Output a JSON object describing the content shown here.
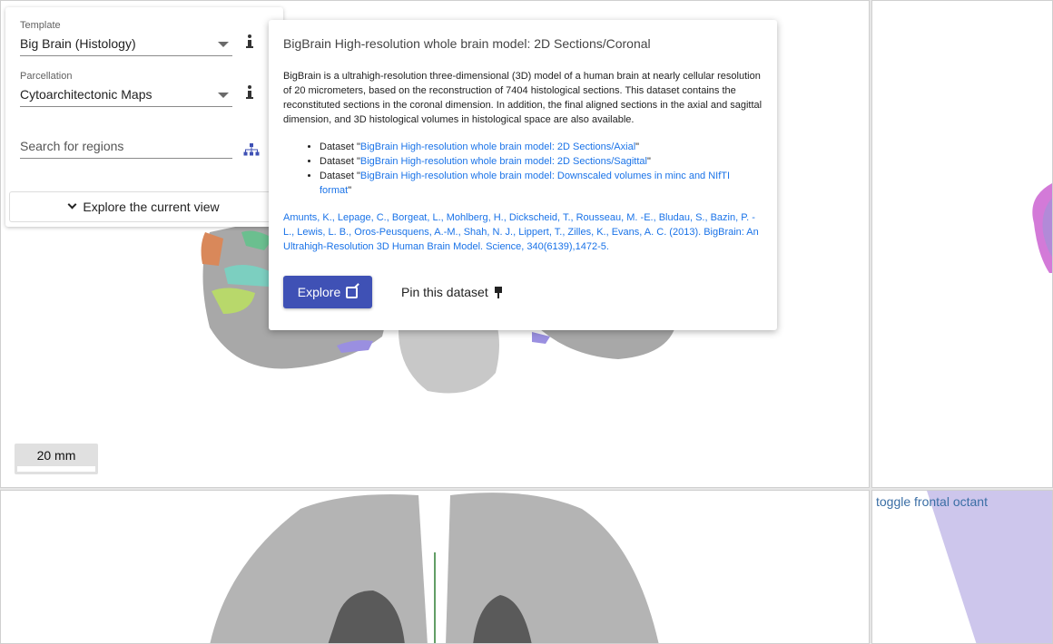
{
  "sidebar": {
    "template_label": "Template",
    "template_value": "Big Brain (Histology)",
    "parcellation_label": "Parcellation",
    "parcellation_value": "Cytoarchitectonic Maps",
    "search_placeholder": "Search for regions",
    "explore_view_label": "Explore the current view"
  },
  "popup": {
    "title": "BigBrain High-resolution whole brain model: 2D Sections/Coronal",
    "description": "BigBrain is a ultrahigh-resolution three-dimensional (3D) model of a human brain at nearly cellular resolution of 20 micrometers, based on the reconstruction of 7404 histological sections. This dataset contains the reconstituted sections in the coronal dimension. In addition, the final aligned sections in the axial and sagittal dimension, and 3D histological volumes in histological space are also available.",
    "datasets": [
      {
        "prefix": "Dataset \"",
        "link": "BigBrain High-resolution whole brain model: 2D Sections/Axial",
        "suffix": "\""
      },
      {
        "prefix": "Dataset \"",
        "link": "BigBrain High-resolution whole brain model: 2D Sections/Sagittal",
        "suffix": "\""
      },
      {
        "prefix": "Dataset \"",
        "link": "BigBrain High-resolution whole brain model: Downscaled volumes in minc and NIfTI format",
        "suffix": "\""
      }
    ],
    "citation": "Amunts, K., Lepage, C., Borgeat, L., Mohlberg, H., Dickscheid, T., Rousseau, M. -E., Bludau, S., Bazin, P. -L., Lewis, L. B., Oros-Peusquens, A.-M., Shah, N. J., Lippert, T., Zilles, K., Evans, A. C. (2013). BigBrain: An Ultrahigh-Resolution 3D Human Brain Model. Science, 340(6139),1472-5.",
    "explore_label": "Explore",
    "pin_label": "Pin this dataset"
  },
  "scale_bar": {
    "label": "20 mm"
  },
  "octant_toggle": {
    "label": "toggle frontal octant"
  },
  "colors": {
    "accent": "#3f51b5",
    "link": "#1a73e8",
    "crosshair": "#2e7d32"
  }
}
